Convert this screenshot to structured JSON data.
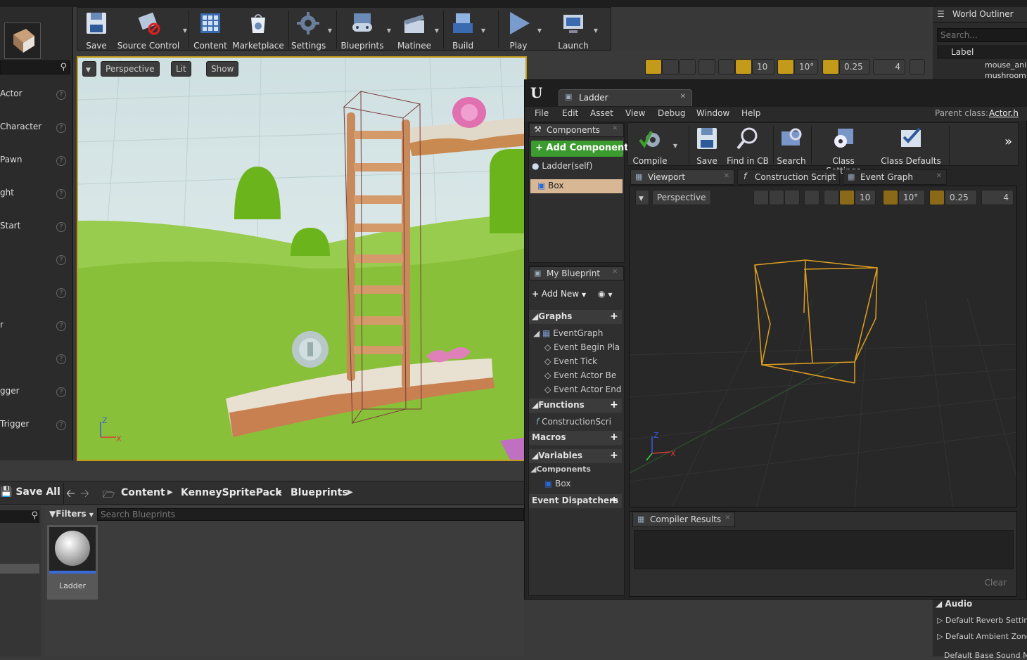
{
  "toolbar": {
    "items": [
      {
        "label": "Save"
      },
      {
        "label": "Source Control"
      },
      {
        "label": "Content"
      },
      {
        "label": "Marketplace"
      },
      {
        "label": "Settings"
      },
      {
        "label": "Blueprints"
      },
      {
        "label": "Matinee"
      },
      {
        "label": "Build"
      },
      {
        "label": "Play"
      },
      {
        "label": "Launch"
      }
    ]
  },
  "modes": {
    "items": [
      "Actor",
      "Character",
      "Pawn",
      "ght",
      "Start",
      "",
      "",
      "r",
      "",
      "gger",
      "Trigger"
    ]
  },
  "viewport": {
    "perspective": "Perspective",
    "lit": "Lit",
    "show": "Show",
    "grid": "10",
    "angle": "10°",
    "scale": "0.25",
    "speed": "4"
  },
  "outliner": {
    "title": "World Outliner",
    "search_placeholder": "Search...",
    "col_label": "Label",
    "rows": [
      "mouse_ani",
      "mushroom"
    ]
  },
  "details": {
    "section": "Audio",
    "rows": [
      "Default Reverb Settings",
      "Default Ambient Zone",
      "Default Base Sound M"
    ]
  },
  "content_browser": {
    "save_all": "Save All",
    "breadcrumb": [
      "Content",
      "KenneySpritePack",
      "Blueprints"
    ],
    "filters": "Filters",
    "search_placeholder": "Search Blueprints",
    "asset_name": "Ladder"
  },
  "blueprint": {
    "tab_title": "Ladder",
    "menu": [
      "File",
      "Edit",
      "Asset",
      "View",
      "Debug",
      "Window",
      "Help"
    ],
    "parent_class_label": "Parent class:",
    "parent_class_value": "Actor.h",
    "components_title": "Components",
    "add_component": "+ Add Component",
    "components": [
      "Ladder(self)",
      "Box"
    ],
    "toolbar": [
      "Compile",
      "Save",
      "Find in CB",
      "Search",
      "Class Settings",
      "Class Defaults"
    ],
    "my_blueprint_title": "My Blueprint",
    "add_new": "Add New",
    "graphs": "Graphs",
    "event_graph": "EventGraph",
    "events": [
      "Event Begin Pla",
      "Event Tick",
      "Event Actor Be",
      "Event Actor End"
    ],
    "functions": "Functions",
    "construction_script_fn": "ConstructionScri",
    "macros": "Macros",
    "variables": "Variables",
    "components_section": "Components",
    "var_box": "Box",
    "event_dispatchers": "Event Dispatchers",
    "tabs": [
      "Viewport",
      "Construction Script",
      "Event Graph"
    ],
    "vp_perspective": "Perspective",
    "vp_grid": "10",
    "vp_angle": "10°",
    "vp_scale": "0.25",
    "vp_speed": "4",
    "compiler_results": "Compiler Results",
    "clear": "Clear"
  },
  "colors": {
    "accent_orange": "#c49a1a",
    "add_component_green": "#3c9b2e",
    "box_wire": "#d6a22a",
    "grass": "#8cc43c"
  }
}
